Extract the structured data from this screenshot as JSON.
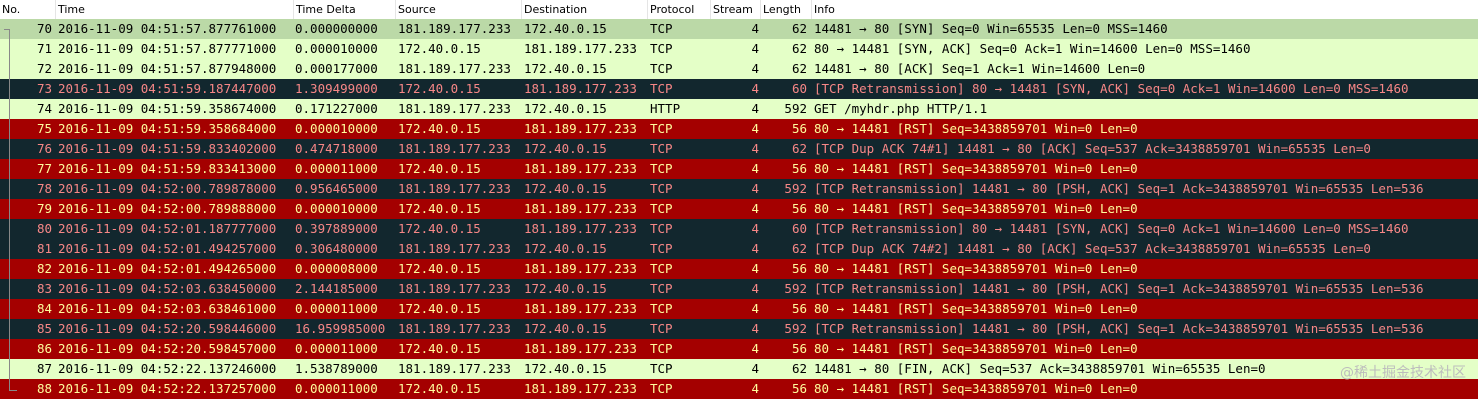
{
  "columns": {
    "no": "No.",
    "time": "Time",
    "delta": "Time Delta",
    "source": "Source",
    "destination": "Destination",
    "protocol": "Protocol",
    "stream": "Stream",
    "length": "Length",
    "info": "Info"
  },
  "row_colors": {
    "selected": "#bbd9a7",
    "green": "#e4ffc7",
    "dark": "#12272e",
    "red": "#a40000"
  },
  "rows": [
    {
      "no": "70",
      "time": "2016-11-09 04:51:57.877761000",
      "delta": "0.000000000",
      "src": "181.189.177.233",
      "dst": "172.40.0.15",
      "proto": "TCP",
      "stream": "4",
      "len": "62",
      "info": "14481 → 80 [SYN] Seq=0 Win=65535 Len=0 MSS=1460",
      "style": "sel"
    },
    {
      "no": "71",
      "time": "2016-11-09 04:51:57.877771000",
      "delta": "0.000010000",
      "src": "172.40.0.15",
      "dst": "181.189.177.233",
      "proto": "TCP",
      "stream": "4",
      "len": "62",
      "info": "80 → 14481 [SYN, ACK] Seq=0 Ack=1 Win=14600 Len=0 MSS=1460",
      "style": "green"
    },
    {
      "no": "72",
      "time": "2016-11-09 04:51:57.877948000",
      "delta": "0.000177000",
      "src": "181.189.177.233",
      "dst": "172.40.0.15",
      "proto": "TCP",
      "stream": "4",
      "len": "62",
      "info": "14481 → 80 [ACK] Seq=1 Ack=1 Win=14600 Len=0",
      "style": "green"
    },
    {
      "no": "73",
      "time": "2016-11-09 04:51:59.187447000",
      "delta": "1.309499000",
      "src": "172.40.0.15",
      "dst": "181.189.177.233",
      "proto": "TCP",
      "stream": "4",
      "len": "60",
      "info": "[TCP Retransmission] 80 → 14481 [SYN, ACK] Seq=0 Ack=1 Win=14600 Len=0 MSS=1460",
      "style": "dark"
    },
    {
      "no": "74",
      "time": "2016-11-09 04:51:59.358674000",
      "delta": "0.171227000",
      "src": "181.189.177.233",
      "dst": "172.40.0.15",
      "proto": "HTTP",
      "stream": "4",
      "len": "592",
      "info": "GET /myhdr.php HTTP/1.1",
      "style": "green"
    },
    {
      "no": "75",
      "time": "2016-11-09 04:51:59.358684000",
      "delta": "0.000010000",
      "src": "172.40.0.15",
      "dst": "181.189.177.233",
      "proto": "TCP",
      "stream": "4",
      "len": "56",
      "info": "80 → 14481 [RST] Seq=3438859701 Win=0 Len=0",
      "style": "red"
    },
    {
      "no": "76",
      "time": "2016-11-09 04:51:59.833402000",
      "delta": "0.474718000",
      "src": "181.189.177.233",
      "dst": "172.40.0.15",
      "proto": "TCP",
      "stream": "4",
      "len": "62",
      "info": "[TCP Dup ACK 74#1] 14481 → 80 [ACK] Seq=537 Ack=3438859701 Win=65535 Len=0",
      "style": "dark"
    },
    {
      "no": "77",
      "time": "2016-11-09 04:51:59.833413000",
      "delta": "0.000011000",
      "src": "172.40.0.15",
      "dst": "181.189.177.233",
      "proto": "TCP",
      "stream": "4",
      "len": "56",
      "info": "80 → 14481 [RST] Seq=3438859701 Win=0 Len=0",
      "style": "red"
    },
    {
      "no": "78",
      "time": "2016-11-09 04:52:00.789878000",
      "delta": "0.956465000",
      "src": "181.189.177.233",
      "dst": "172.40.0.15",
      "proto": "TCP",
      "stream": "4",
      "len": "592",
      "info": "[TCP Retransmission] 14481 → 80 [PSH, ACK] Seq=1 Ack=3438859701 Win=65535 Len=536",
      "style": "dark"
    },
    {
      "no": "79",
      "time": "2016-11-09 04:52:00.789888000",
      "delta": "0.000010000",
      "src": "172.40.0.15",
      "dst": "181.189.177.233",
      "proto": "TCP",
      "stream": "4",
      "len": "56",
      "info": "80 → 14481 [RST] Seq=3438859701 Win=0 Len=0",
      "style": "red"
    },
    {
      "no": "80",
      "time": "2016-11-09 04:52:01.187777000",
      "delta": "0.397889000",
      "src": "172.40.0.15",
      "dst": "181.189.177.233",
      "proto": "TCP",
      "stream": "4",
      "len": "60",
      "info": "[TCP Retransmission] 80 → 14481 [SYN, ACK] Seq=0 Ack=1 Win=14600 Len=0 MSS=1460",
      "style": "dark"
    },
    {
      "no": "81",
      "time": "2016-11-09 04:52:01.494257000",
      "delta": "0.306480000",
      "src": "181.189.177.233",
      "dst": "172.40.0.15",
      "proto": "TCP",
      "stream": "4",
      "len": "62",
      "info": "[TCP Dup ACK 74#2] 14481 → 80 [ACK] Seq=537 Ack=3438859701 Win=65535 Len=0",
      "style": "dark"
    },
    {
      "no": "82",
      "time": "2016-11-09 04:52:01.494265000",
      "delta": "0.000008000",
      "src": "172.40.0.15",
      "dst": "181.189.177.233",
      "proto": "TCP",
      "stream": "4",
      "len": "56",
      "info": "80 → 14481 [RST] Seq=3438859701 Win=0 Len=0",
      "style": "red"
    },
    {
      "no": "83",
      "time": "2016-11-09 04:52:03.638450000",
      "delta": "2.144185000",
      "src": "181.189.177.233",
      "dst": "172.40.0.15",
      "proto": "TCP",
      "stream": "4",
      "len": "592",
      "info": "[TCP Retransmission] 14481 → 80 [PSH, ACK] Seq=1 Ack=3438859701 Win=65535 Len=536",
      "style": "dark"
    },
    {
      "no": "84",
      "time": "2016-11-09 04:52:03.638461000",
      "delta": "0.000011000",
      "src": "172.40.0.15",
      "dst": "181.189.177.233",
      "proto": "TCP",
      "stream": "4",
      "len": "56",
      "info": "80 → 14481 [RST] Seq=3438859701 Win=0 Len=0",
      "style": "red"
    },
    {
      "no": "85",
      "time": "2016-11-09 04:52:20.598446000",
      "delta": "16.959985000",
      "src": "181.189.177.233",
      "dst": "172.40.0.15",
      "proto": "TCP",
      "stream": "4",
      "len": "592",
      "info": "[TCP Retransmission] 14481 → 80 [PSH, ACK] Seq=1 Ack=3438859701 Win=65535 Len=536",
      "style": "dark"
    },
    {
      "no": "86",
      "time": "2016-11-09 04:52:20.598457000",
      "delta": "0.000011000",
      "src": "172.40.0.15",
      "dst": "181.189.177.233",
      "proto": "TCP",
      "stream": "4",
      "len": "56",
      "info": "80 → 14481 [RST] Seq=3438859701 Win=0 Len=0",
      "style": "red"
    },
    {
      "no": "87",
      "time": "2016-11-09 04:52:22.137246000",
      "delta": "1.538789000",
      "src": "181.189.177.233",
      "dst": "172.40.0.15",
      "proto": "TCP",
      "stream": "4",
      "len": "62",
      "info": "14481 → 80 [FIN, ACK] Seq=537 Ack=3438859701 Win=65535 Len=0",
      "style": "green"
    },
    {
      "no": "88",
      "time": "2016-11-09 04:52:22.137257000",
      "delta": "0.000011000",
      "src": "172.40.0.15",
      "dst": "181.189.177.233",
      "proto": "TCP",
      "stream": "4",
      "len": "56",
      "info": "80 → 14481 [RST] Seq=3438859701 Win=0 Len=0",
      "style": "red"
    }
  ],
  "watermark": "@稀土掘金技术社区"
}
